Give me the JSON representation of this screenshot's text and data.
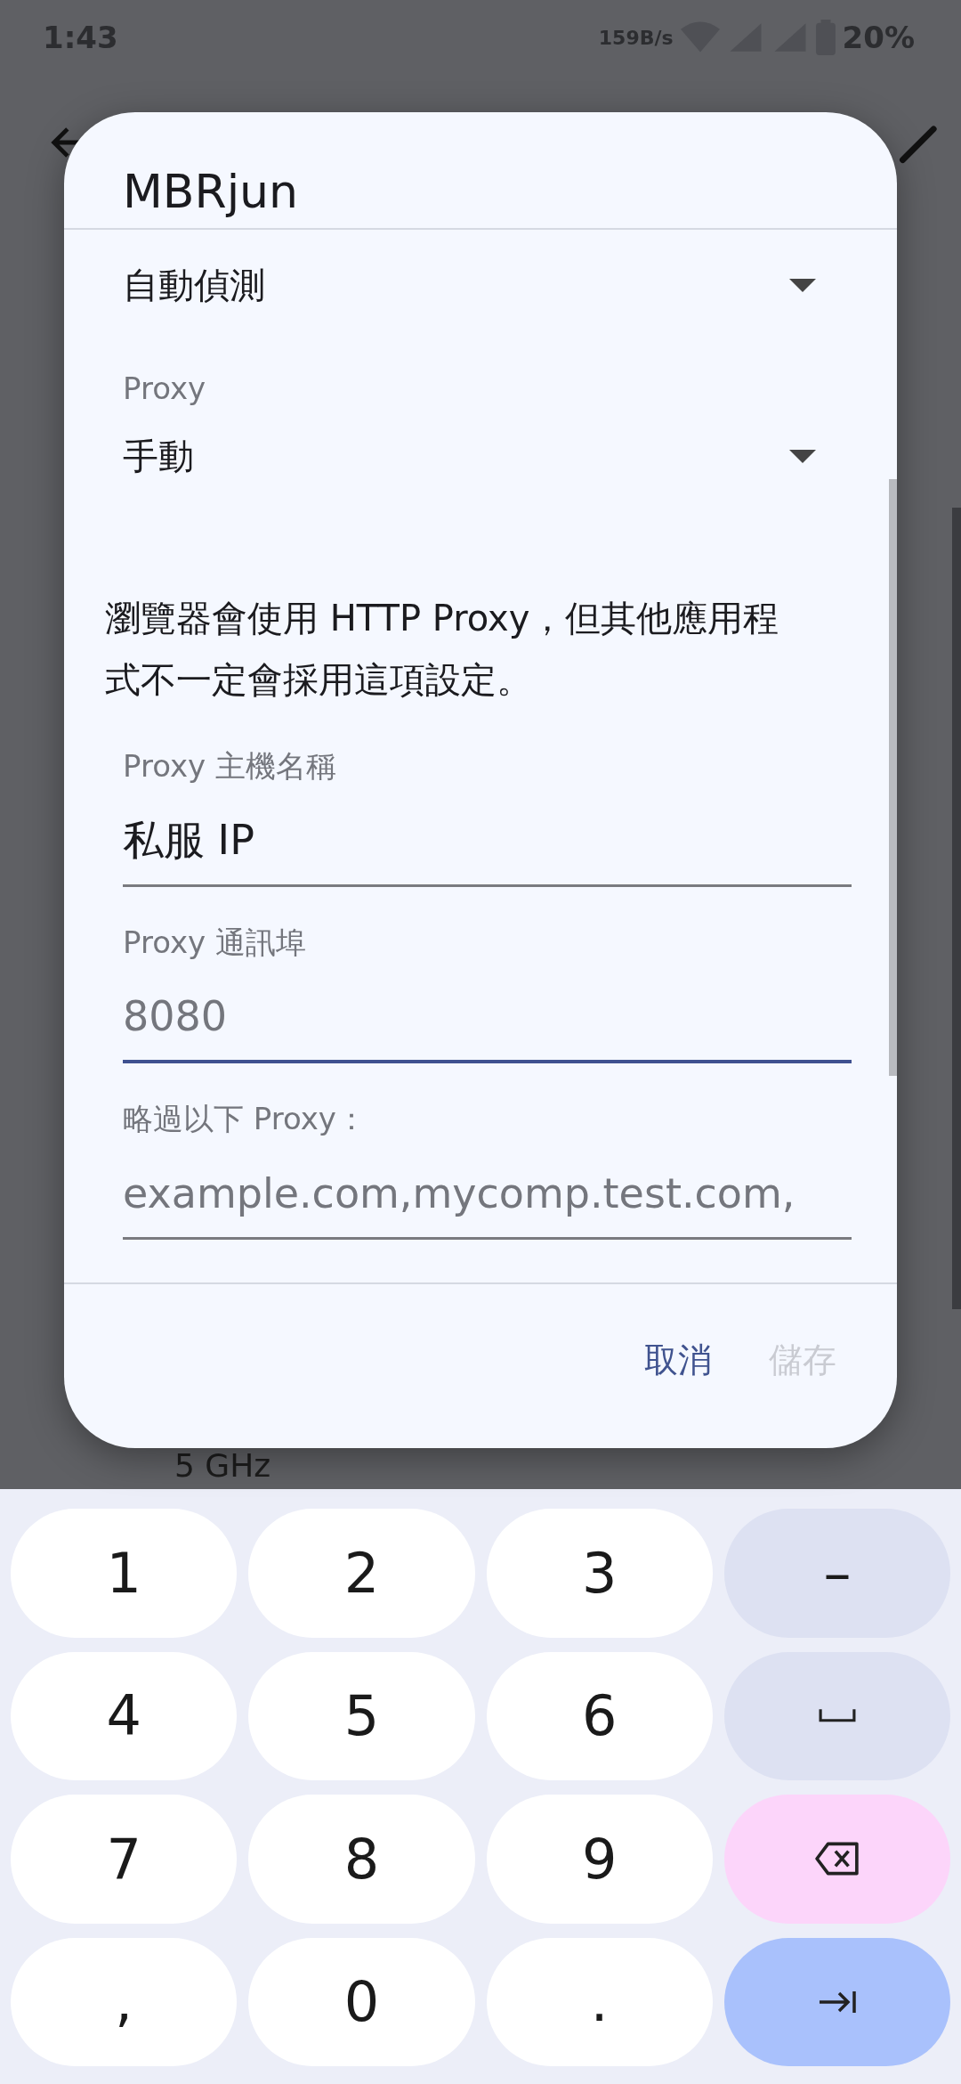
{
  "status_bar": {
    "time": "1:43",
    "net_speed": "159B/s",
    "battery": "20%"
  },
  "background": {
    "band": "5 GHz"
  },
  "dialog": {
    "title": "MBRjun",
    "dropdowns": [
      {
        "value": "自動偵測"
      },
      {
        "label": "Proxy",
        "value": "手動"
      }
    ],
    "info": "瀏覽器會使用 HTTP Proxy，但其他應用程式不一定會採用這項設定。",
    "fields": [
      {
        "label": "Proxy 主機名稱",
        "value": "私服 IP",
        "focused": false
      },
      {
        "label": "Proxy 通訊埠",
        "placeholder": "8080",
        "focused": true
      },
      {
        "label": "略過以下 Proxy：",
        "placeholder": "example.com,mycomp.test.com,",
        "focused": false
      }
    ],
    "buttons": [
      {
        "label": "取消",
        "disabled": false
      },
      {
        "label": "儲存",
        "disabled": true
      }
    ]
  },
  "keyboard": {
    "keys": [
      {
        "kind": "char",
        "label": "1"
      },
      {
        "kind": "char",
        "label": "2"
      },
      {
        "kind": "char",
        "label": "3"
      },
      {
        "kind": "symbol",
        "label": "–"
      },
      {
        "kind": "char",
        "label": "4"
      },
      {
        "kind": "char",
        "label": "5"
      },
      {
        "kind": "char",
        "label": "6"
      },
      {
        "kind": "space"
      },
      {
        "kind": "char",
        "label": "7"
      },
      {
        "kind": "char",
        "label": "8"
      },
      {
        "kind": "char",
        "label": "9"
      },
      {
        "kind": "delete"
      },
      {
        "kind": "char",
        "label": ","
      },
      {
        "kind": "char",
        "label": "0"
      },
      {
        "kind": "char",
        "label": "."
      },
      {
        "kind": "next"
      }
    ]
  }
}
